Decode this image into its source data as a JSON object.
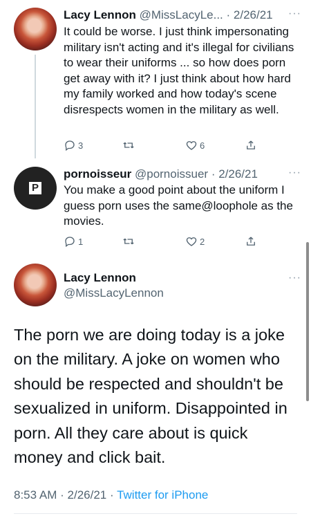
{
  "tweets": [
    {
      "name": "Lacy Lennon",
      "handle": "@MissLacyLe...",
      "separator": "·",
      "date": "2/26/21",
      "text": "It could be worse. I just think impersonating military isn't acting and it's illegal for civilians to wear their uniforms ... so how does porn get away with it? I just think about how hard my family worked and how today's scene disrespects women in the military as well.",
      "replies": "3",
      "retweets": "",
      "likes": "6"
    },
    {
      "name": "pornoisseur",
      "handle": "@pornoissuer",
      "separator": "·",
      "date": "2/26/21",
      "text": "You make a good point about the uniform I guess porn uses the same@loophole as the movies.",
      "replies": "1",
      "retweets": "",
      "likes": "2",
      "avatar_letter": "P"
    }
  ],
  "main_tweet": {
    "name": "Lacy Lennon",
    "handle": "@MissLacyLennon",
    "text": "The porn we are doing today is a joke on the military. A joke on women who should be respected and shouldn't be sexualized in uniform. Disappointed in porn. All they care about is quick money and click bait.",
    "time": "8:53 AM",
    "date": "2/26/21",
    "dot": "·",
    "source": "Twitter for iPhone"
  },
  "more_icon": "···",
  "icons": [
    "reply-icon",
    "retweet-icon",
    "like-icon",
    "share-icon",
    "more-icon"
  ],
  "colors": {
    "link": "#1d9bf0",
    "meta": "#536471",
    "text": "#0f1419"
  }
}
